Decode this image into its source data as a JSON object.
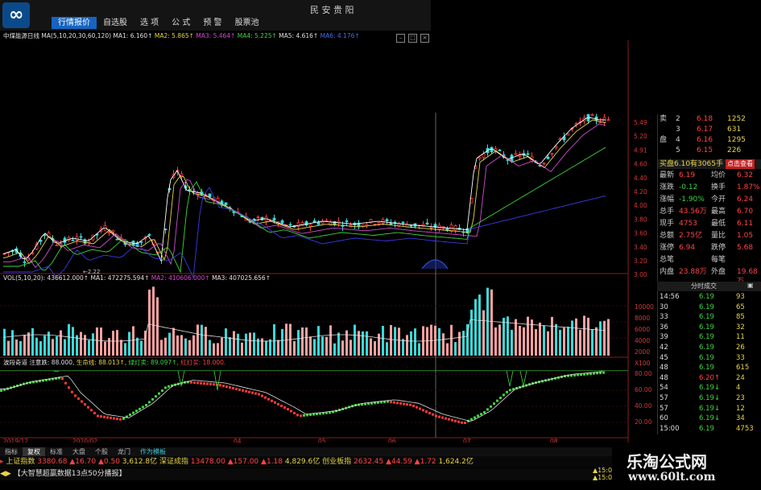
{
  "app": {
    "title": "民 安 贵 阳",
    "logo": "logo-icon"
  },
  "menu": [
    {
      "label": "行情报价",
      "active": true
    },
    {
      "label": "自选股",
      "active": false
    },
    {
      "label": "选 项",
      "active": false
    },
    {
      "label": "公 式",
      "active": false
    },
    {
      "label": "预 警",
      "active": false
    },
    {
      "label": "股票池",
      "active": false
    }
  ],
  "chart_header": {
    "stock": "中煤能源日线",
    "ma_params": "MA(5,10,20,30,60,120)",
    "ma1": "MA1: 6.160↑",
    "ma2": "MA2: 5.865↑",
    "ma3": "MA3: 5.464↑",
    "ma4": "MA4: 5.225↑",
    "ma5": "MA5: 4.616↑",
    "ma6": "MA6: 4.176↑"
  },
  "price_axis": [
    "5.49",
    "5.20",
    "4.91",
    "4.60",
    "4.40",
    "4.20",
    "4.00",
    "3.80",
    "3.60",
    "3.40",
    "3.20",
    "3.00"
  ],
  "price_low_label": "2.22",
  "vol_header": {
    "vol": "VOL(5,10,20): 436612.000↑",
    "ma1": "MA1: 472275.594↑",
    "ma2": "MA2: 410606.000↑",
    "ma3": "MA3: 407025.656↑"
  },
  "vol_axis": [
    "10000",
    "8000",
    "6000",
    "4000",
    "2000",
    "X100"
  ],
  "ind_header": {
    "name": "波段奇道",
    "a": "注意跌: 88.000,",
    "b": "生命线: 88.013↑,",
    "c": "绿灯卖: 89.097↑,",
    "d": "红灯买: 18.000."
  },
  "ind_axis": [
    "80.00",
    "60.00",
    "40.00",
    "20.00"
  ],
  "date_axis": [
    "2019/12",
    "2020/02",
    "04",
    "05",
    "06",
    "07",
    "08"
  ],
  "quote": {
    "asks": [
      {
        "label": "卖",
        "n": "2",
        "price": "6.18",
        "vol": "1252"
      },
      {
        "label": "",
        "n": "3",
        "price": "6.17",
        "vol": "631"
      },
      {
        "label": "盘",
        "n": "4",
        "price": "6.16",
        "vol": "1295"
      },
      {
        "label": "",
        "n": "5",
        "price": "6.15",
        "vol": "226"
      }
    ],
    "buy_line": "买盘6.10有3065手",
    "buy_btn": "点击查看",
    "fields": [
      {
        "k": "最新",
        "v": "6.19",
        "k2": "均价",
        "v2": "6.32"
      },
      {
        "k": "涨跌",
        "v": "-0.12",
        "k2": "换手",
        "v2": "1.87%"
      },
      {
        "k": "涨幅",
        "v": "-1.90%",
        "k2": "今开",
        "v2": "6.24"
      },
      {
        "k": "总手",
        "v": "43.56万",
        "k2": "最高",
        "v2": "6.70"
      },
      {
        "k": "现手",
        "v": "4753",
        "k2": "最低",
        "v2": "6.11"
      },
      {
        "k": "总额",
        "v": "2.75亿",
        "k2": "量比",
        "v2": "1.05"
      },
      {
        "k": "涨停",
        "v": "6.94",
        "k2": "跌停",
        "v2": "5.68"
      },
      {
        "k": "总笔",
        "v": "",
        "k2": "每笔",
        "v2": ""
      },
      {
        "k": "内盘",
        "v": "23.88万",
        "k2": "外盘",
        "v2": "19.68万"
      }
    ],
    "trade_tab": "分时成交",
    "trades": [
      {
        "t": "14:56",
        "p": "6.19",
        "v": "93"
      },
      {
        "t": "30",
        "p": "6.19",
        "v": "65"
      },
      {
        "t": "33",
        "p": "6.19",
        "v": "85"
      },
      {
        "t": "36",
        "p": "6.19",
        "v": "32"
      },
      {
        "t": "39",
        "p": "6.19",
        "v": "11"
      },
      {
        "t": "42",
        "p": "6.19",
        "v": "26"
      },
      {
        "t": "45",
        "p": "6.19",
        "v": "33"
      },
      {
        "t": "48",
        "p": "6.19",
        "v": "615"
      },
      {
        "t": "48",
        "p": "6.20↑",
        "v": "24"
      },
      {
        "t": "54",
        "p": "6.19↓",
        "v": "4"
      },
      {
        "t": "57",
        "p": "6.19↓",
        "v": "23"
      },
      {
        "t": "57",
        "p": "6.19↓",
        "v": "12"
      },
      {
        "t": "60",
        "p": "6.19↓",
        "v": "34"
      },
      {
        "t": "15:00",
        "p": "6.19",
        "v": "4753"
      }
    ]
  },
  "bottom_tabs": [
    "指标",
    "复权",
    "标准",
    "大盘",
    "个股",
    "龙门",
    "作为模板"
  ],
  "ticker": {
    "sh_name": "上证指数",
    "sh_val": "3380.68",
    "sh_chg": "▲16.70",
    "sh_pct": "▲0.50",
    "sh_amt": "3,612.8亿",
    "sz_name": "深证成指",
    "sz_val": "13478.00",
    "sz_chg": "▲157.00",
    "sz_pct": "▲1.18",
    "sz_amt": "4,829.6亿",
    "cy_name": "创业板指",
    "cy_val": "2632.45",
    "cy_chg": "▲44.59",
    "cy_pct": "▲1.72",
    "cy_amt": "1,624.2亿"
  },
  "status": {
    "text": "【大智慧超赢数据13点50分播报】",
    "time1": "▲15:0",
    "time2": "▲15:0"
  },
  "watermark": {
    "text": "乐淘公式网",
    "url": "www.60lt.com"
  }
}
